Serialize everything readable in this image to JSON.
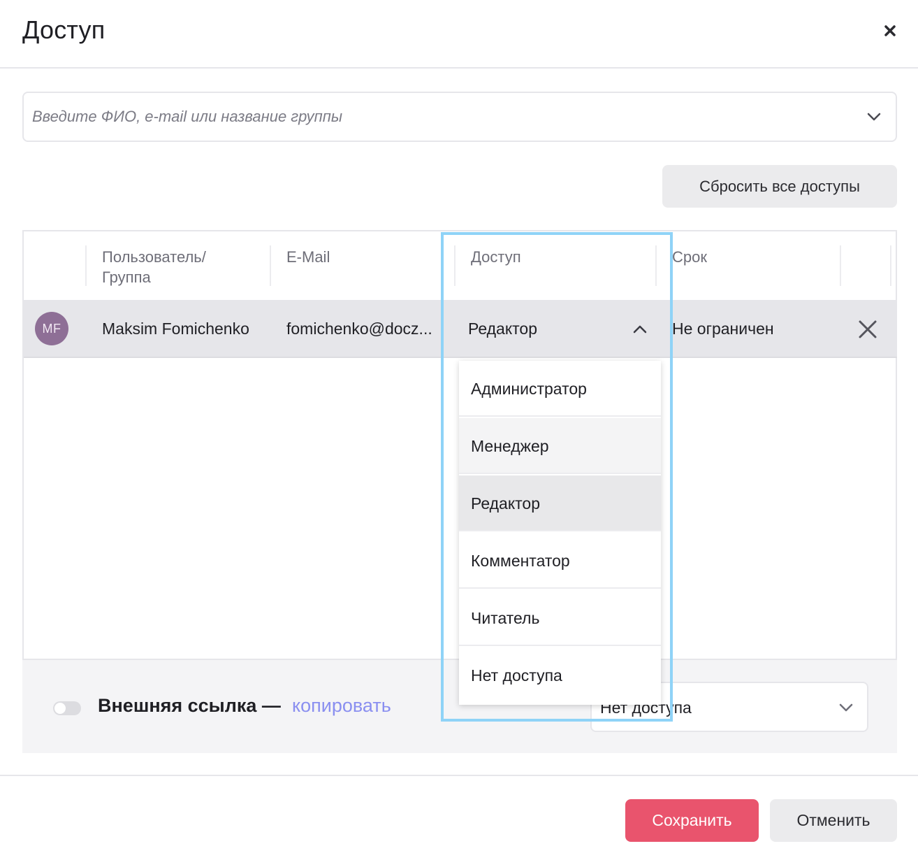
{
  "dialog": {
    "title": "Доступ"
  },
  "search": {
    "placeholder": "Введите ФИО, e-mail или название группы"
  },
  "toolbar": {
    "reset_label": "Сбросить все доступы"
  },
  "table": {
    "columns": [
      "Пользователь/ Группа",
      "E-Mail",
      "Доступ",
      "Срок"
    ],
    "rows": [
      {
        "initials": "MF",
        "name": "Maksim Fomichenko",
        "email": "fomichenko@docz...",
        "access": "Редактор",
        "term": "Не ограничен"
      }
    ]
  },
  "access_dropdown": {
    "options": [
      "Администратор",
      "Менеджер",
      "Редактор",
      "Комментатор",
      "Читатель",
      "Нет доступа"
    ],
    "selected": "Редактор",
    "hovered": "Менеджер"
  },
  "external_link": {
    "label": "Внешняя ссылка —",
    "copy_label": "копировать",
    "access_value": "Нет доступа",
    "enabled": false
  },
  "footer": {
    "save_label": "Сохранить",
    "cancel_label": "Отменить"
  },
  "colors": {
    "accent": "#e9546d",
    "link": "#8a8ff0",
    "avatar": "#8e6f96",
    "highlight": "#8fd3f7"
  }
}
